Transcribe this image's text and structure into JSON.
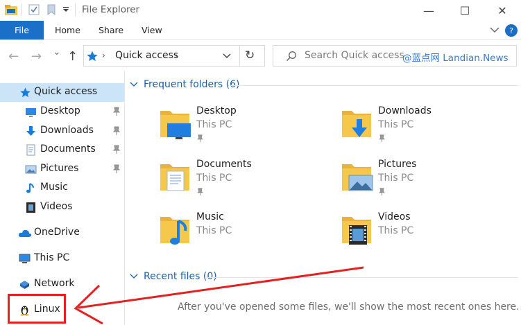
{
  "window": {
    "title": "File Explorer",
    "minimize_glyph": "—",
    "maximize_glyph": "☐",
    "close_glyph": "✕"
  },
  "ribbon": {
    "file_tab": "File",
    "tabs": [
      "Home",
      "Share",
      "View"
    ]
  },
  "navigation": {
    "back_glyph": "←",
    "forward_glyph": "→",
    "recent_glyph": "⌄",
    "up_glyph": "↑",
    "address_separator": "›",
    "address_location": "Quick access",
    "refresh_glyph": "↻",
    "search_placeholder": "Search Quick access",
    "watermark": "@蓝点网 Landian.News"
  },
  "sidebar": {
    "items": [
      {
        "label": "Quick access",
        "icon": "star-icon",
        "selected": true
      },
      {
        "label": "Desktop",
        "icon": "desktop-icon",
        "pinned": true
      },
      {
        "label": "Downloads",
        "icon": "download-icon",
        "pinned": true
      },
      {
        "label": "Documents",
        "icon": "documents-icon",
        "pinned": true
      },
      {
        "label": "Pictures",
        "icon": "pictures-icon",
        "pinned": true
      },
      {
        "label": "Music",
        "icon": "music-icon"
      },
      {
        "label": "Videos",
        "icon": "videos-icon"
      },
      {
        "label": "OneDrive",
        "icon": "cloud-icon"
      },
      {
        "label": "This PC",
        "icon": "computer-icon"
      },
      {
        "label": "Network",
        "icon": "network-icon"
      },
      {
        "label": "Linux",
        "icon": "penguin-icon",
        "highlighted": true
      }
    ]
  },
  "main": {
    "frequent_header": "Frequent folders (6)",
    "recent_header": "Recent files (0)",
    "recent_empty": "After you've opened some files, we'll show the most recent ones here.",
    "folders": [
      {
        "name": "Desktop",
        "location": "This PC",
        "overlay": "desktop"
      },
      {
        "name": "Downloads",
        "location": "This PC",
        "overlay": "download"
      },
      {
        "name": "Documents",
        "location": "This PC",
        "overlay": "documents"
      },
      {
        "name": "Pictures",
        "location": "This PC",
        "overlay": "pictures"
      },
      {
        "name": "Music",
        "location": "This PC",
        "overlay": "music"
      },
      {
        "name": "Videos",
        "location": "This PC",
        "overlay": "videos"
      }
    ]
  },
  "colors": {
    "accent": "#1a6fc9",
    "selection": "#cce4f7",
    "annotation_red": "#e52020",
    "folder_yellow": "#f5c84c"
  }
}
